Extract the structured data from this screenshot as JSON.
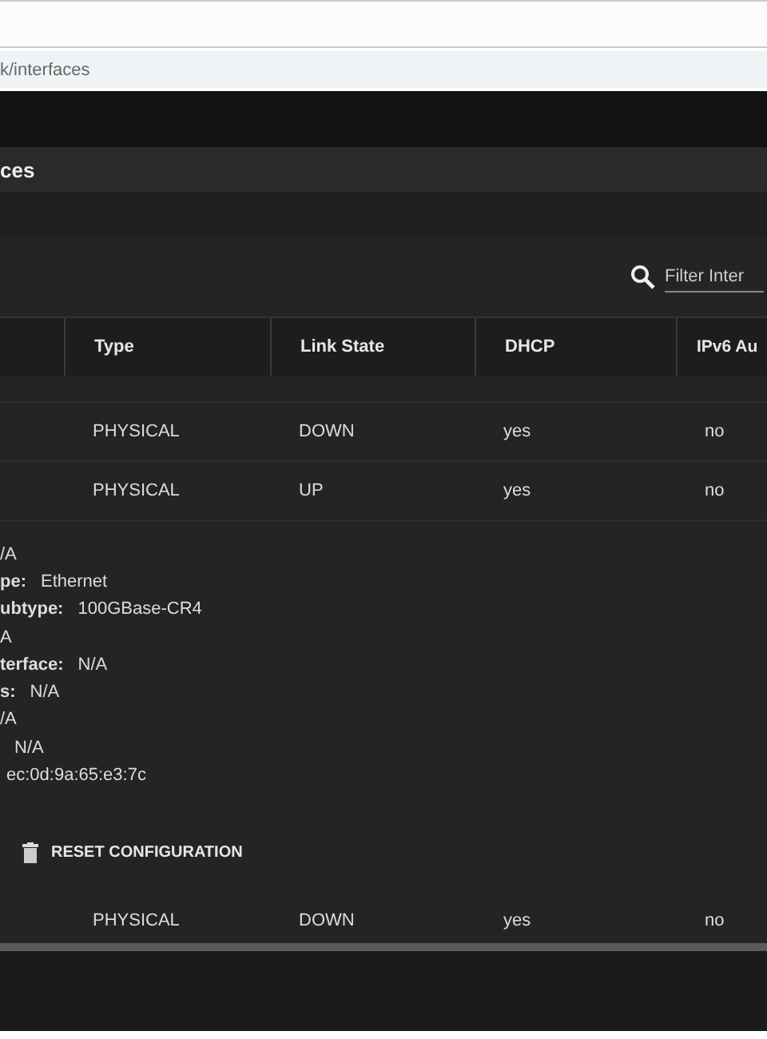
{
  "browser": {
    "address": "k/interfaces"
  },
  "page": {
    "title": "ces"
  },
  "filter": {
    "placeholder": "Filter Inter"
  },
  "table": {
    "columns": [
      "",
      "Type",
      "Link State",
      "DHCP",
      "IPv6 Au"
    ],
    "rows": [
      {
        "cells": [
          "",
          "PHYSICAL",
          "DOWN",
          "yes",
          "no"
        ]
      },
      {
        "cells": [
          "",
          "PHYSICAL",
          "UP",
          "yes",
          "no"
        ]
      }
    ],
    "details": [
      {
        "value": "/A"
      },
      {
        "label": "pe:",
        "value": "Ethernet"
      },
      {
        "label": "ubtype:",
        "value": "100GBase-CR4"
      },
      {
        "value": "A"
      },
      {
        "label": "terface:",
        "value": "N/A"
      },
      {
        "label": "s:",
        "value": "N/A"
      },
      {
        "value": "/A"
      },
      {
        "value": "N/A",
        "indent": true
      },
      {
        "value": "ec:0d:9a:65:e3:7c"
      }
    ],
    "action": "RESET CONFIGURATION",
    "rows_after": [
      {
        "cells": [
          "",
          "PHYSICAL",
          "DOWN",
          "yes",
          "no"
        ]
      }
    ]
  }
}
